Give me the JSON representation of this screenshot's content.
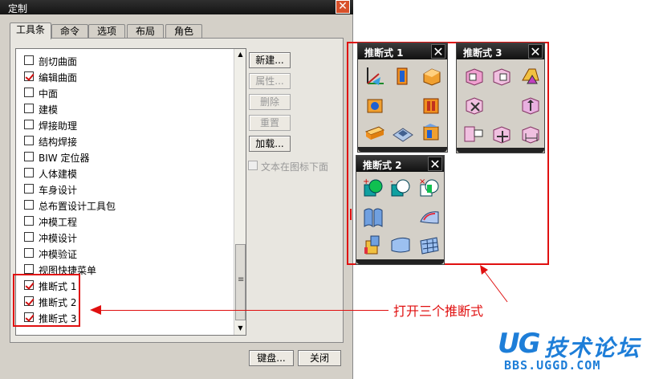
{
  "dialog": {
    "title": "定制",
    "close_label": "✕",
    "tabs": [
      {
        "label": "工具条",
        "active": true
      },
      {
        "label": "命令"
      },
      {
        "label": "选项"
      },
      {
        "label": "布局"
      },
      {
        "label": "角色"
      }
    ],
    "toolbar_items": [
      {
        "label": "剖切曲面",
        "checked": false
      },
      {
        "label": "编辑曲面",
        "checked": true
      },
      {
        "label": "中面",
        "checked": false
      },
      {
        "label": "建模",
        "checked": false
      },
      {
        "label": "焊接助理",
        "checked": false
      },
      {
        "label": "结构焊接",
        "checked": false
      },
      {
        "label": "BIW 定位器",
        "checked": false
      },
      {
        "label": "人体建模",
        "checked": false
      },
      {
        "label": "车身设计",
        "checked": false
      },
      {
        "label": "总布置设计工具包",
        "checked": false
      },
      {
        "label": "冲模工程",
        "checked": false
      },
      {
        "label": "冲模设计",
        "checked": false
      },
      {
        "label": "冲模验证",
        "checked": false
      },
      {
        "label": "视图快捷菜单",
        "checked": false
      },
      {
        "label": "推断式 1",
        "checked": true
      },
      {
        "label": "推断式 2",
        "checked": true
      },
      {
        "label": "推断式 3",
        "checked": true
      }
    ],
    "buttons": {
      "new": "新建...",
      "properties": "属性...",
      "delete": "删除",
      "reset": "重置",
      "load": "加载..."
    },
    "text_below_icon_label": "文本在图标下面",
    "keyboard_button": "键盘...",
    "close_button": "关闭"
  },
  "toolbars": [
    {
      "title": "推断式 1",
      "close": "✕"
    },
    {
      "title": "推断式 3",
      "close": "✕"
    },
    {
      "title": "推断式 2",
      "close": "✕"
    }
  ],
  "annotation": "打开三个推断式",
  "logo": {
    "brand": "UG",
    "title": "技术论坛",
    "url": "BBS.UGGD.COM"
  }
}
